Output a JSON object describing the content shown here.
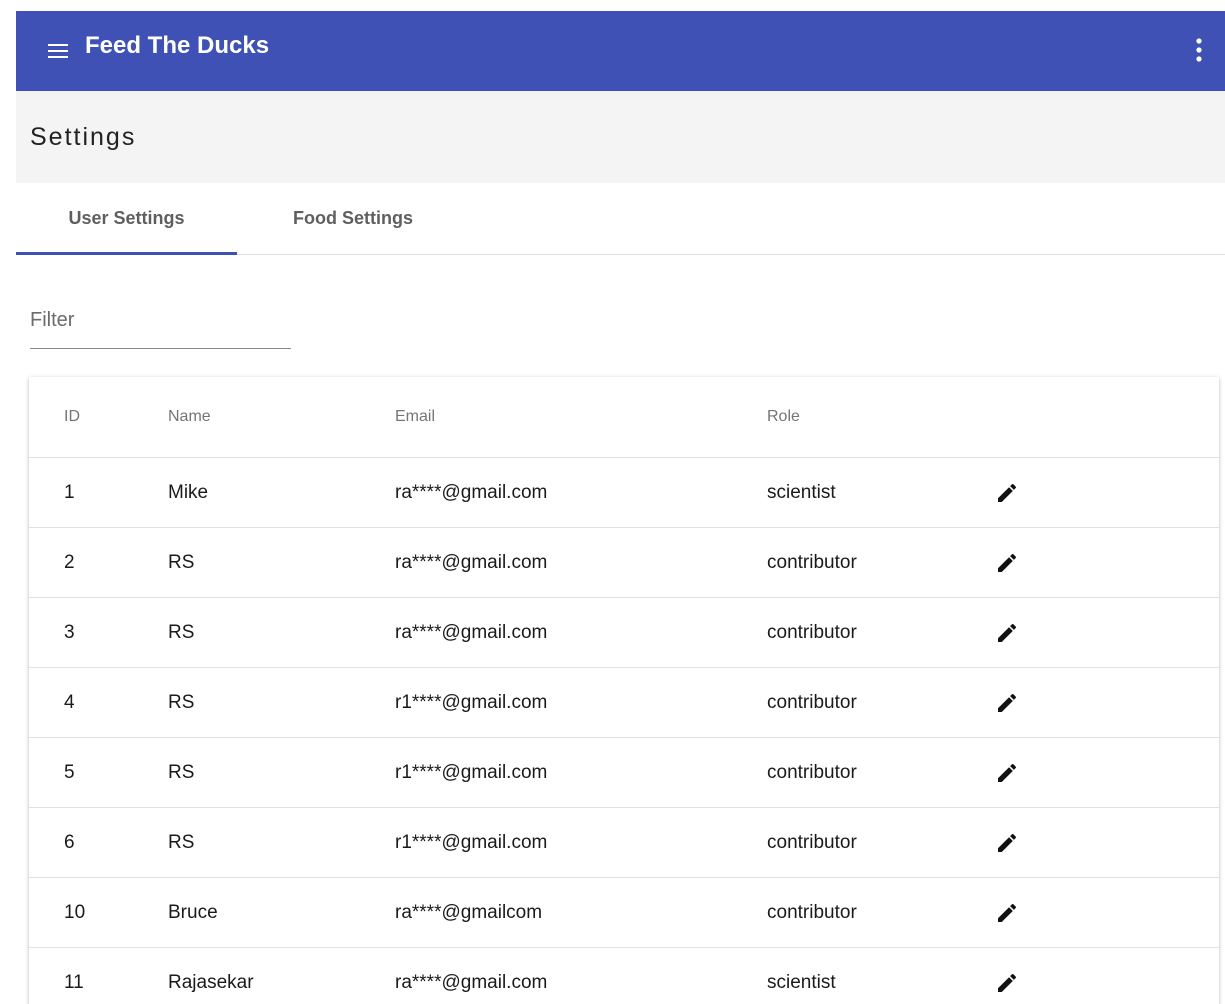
{
  "app": {
    "title": "Feed The Ducks",
    "accent_color": "#3f51b5",
    "menu_icon": "menu-icon",
    "overflow_icon": "more-vert-icon"
  },
  "page": {
    "title": "Settings"
  },
  "tabs": [
    {
      "label": "User Settings",
      "active": true
    },
    {
      "label": "Food Settings",
      "active": false
    }
  ],
  "filter": {
    "placeholder": "Filter",
    "value": ""
  },
  "table": {
    "columns": [
      "ID",
      "Name",
      "Email",
      "Role"
    ],
    "edit_icon": "edit-icon",
    "rows": [
      {
        "id": "1",
        "name": "Mike",
        "email": "ra****@gmail.com",
        "role": "scientist"
      },
      {
        "id": "2",
        "name": "RS",
        "email": "ra****@gmail.com",
        "role": "contributor"
      },
      {
        "id": "3",
        "name": "RS",
        "email": "ra****@gmail.com",
        "role": "contributor"
      },
      {
        "id": "4",
        "name": "RS",
        "email": "r1****@gmail.com",
        "role": "contributor"
      },
      {
        "id": "5",
        "name": "RS",
        "email": "r1****@gmail.com",
        "role": "contributor"
      },
      {
        "id": "6",
        "name": "RS",
        "email": "r1****@gmail.com",
        "role": "contributor"
      },
      {
        "id": "10",
        "name": "Bruce",
        "email": "ra****@gmailcom",
        "role": "contributor"
      },
      {
        "id": "11",
        "name": "Rajasekar",
        "email": "ra****@gmail.com",
        "role": "scientist"
      }
    ]
  }
}
